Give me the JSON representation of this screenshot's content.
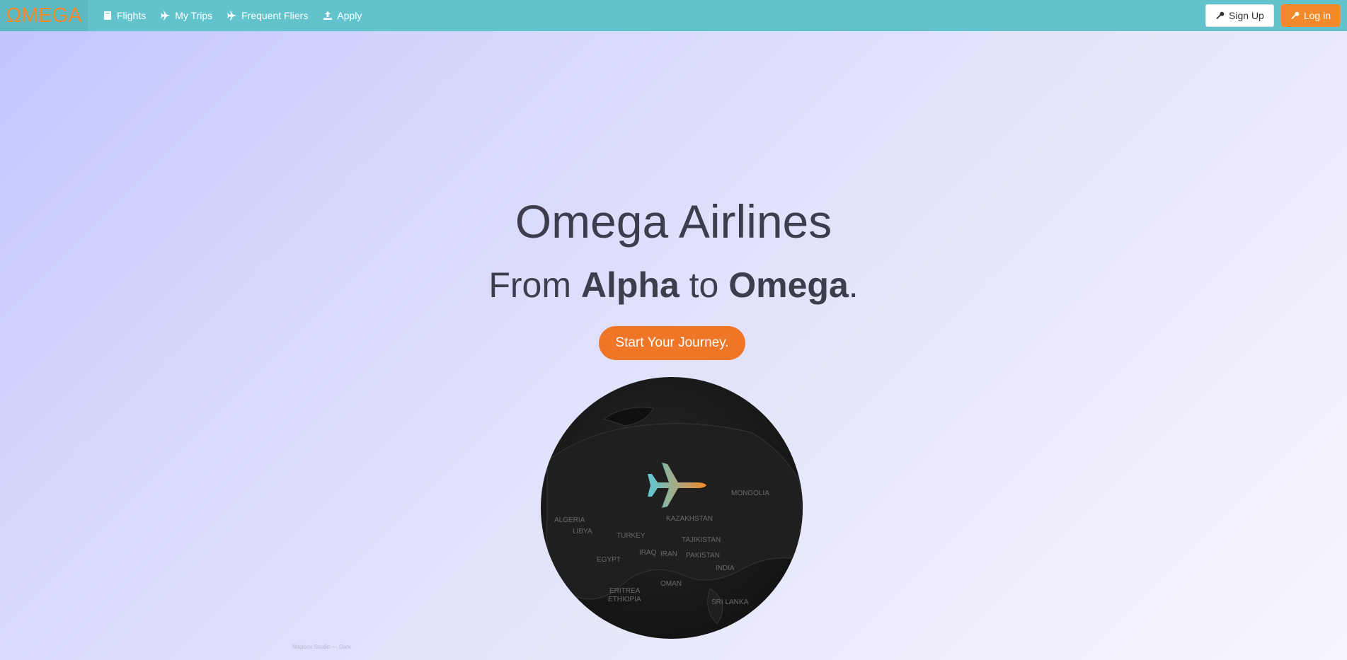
{
  "brand": {
    "logo_text": "ΩMEGA",
    "color": "#f08a2a"
  },
  "nav": {
    "items": [
      {
        "label": "Flights",
        "icon": "book-icon"
      },
      {
        "label": "My Trips",
        "icon": "plane-icon"
      },
      {
        "label": "Frequent Fliers",
        "icon": "plane-icon"
      },
      {
        "label": "Apply",
        "icon": "upload-icon"
      }
    ],
    "signup_label": "Sign Up",
    "login_label": "Log in"
  },
  "hero": {
    "title": "Omega Airlines",
    "subtitle_prefix": "From ",
    "subtitle_bold1": "Alpha",
    "subtitle_mid": " to ",
    "subtitle_bold2": "Omega",
    "subtitle_suffix": ".",
    "cta_label": "Start Your Journey."
  },
  "globe": {
    "labels": [
      "KAZAKHSTAN",
      "TURKEY",
      "TAJIKISTAN",
      "IRAQ",
      "IRAN",
      "PAKISTAN",
      "EGYPT",
      "INDIA",
      "OMAN",
      "ERITREA",
      "ETHIOPIA",
      "SRI LANKA",
      "ALGERIA",
      "LIBYA",
      "MONGOLIA"
    ]
  },
  "attribution": "Mapbox Studio — Dark",
  "colors": {
    "navbar": "#63c3cc",
    "accent": "#f07627",
    "login": "#f28a2c"
  }
}
